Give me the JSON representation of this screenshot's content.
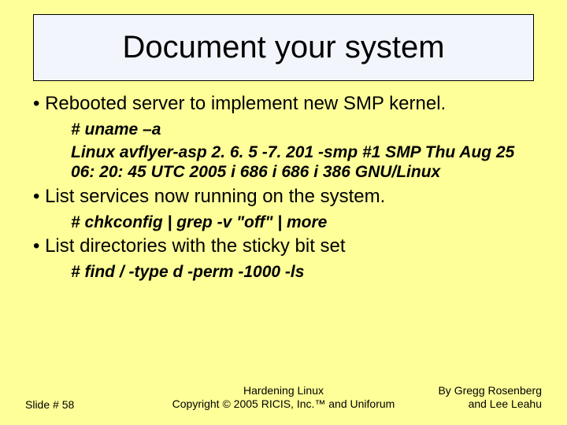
{
  "title": "Document your system",
  "bullets": {
    "b1": "Rebooted server to implement new SMP kernel.",
    "b1_sub1": "# uname –a",
    "b1_sub2": "Linux avflyer-asp 2. 6. 5 -7. 201 -smp #1 SMP Thu Aug 25 06: 20: 45 UTC 2005 i 686 i 686 i 386 GNU/Linux",
    "b2": "List services now running on the system.",
    "b2_sub1": "# chkconfig | grep -v \"off\" | more",
    "b3": "List directories with the sticky bit set",
    "b3_sub1": "# find / -type d -perm -1000 -ls"
  },
  "footer": {
    "slide": "Slide # 58",
    "center_line1": "Hardening Linux",
    "center_line2": "Copyright © 2005 RICIS, Inc.™ and Uniforum",
    "right_line1": "By Gregg Rosenberg",
    "right_line2": "and Lee Leahu"
  }
}
